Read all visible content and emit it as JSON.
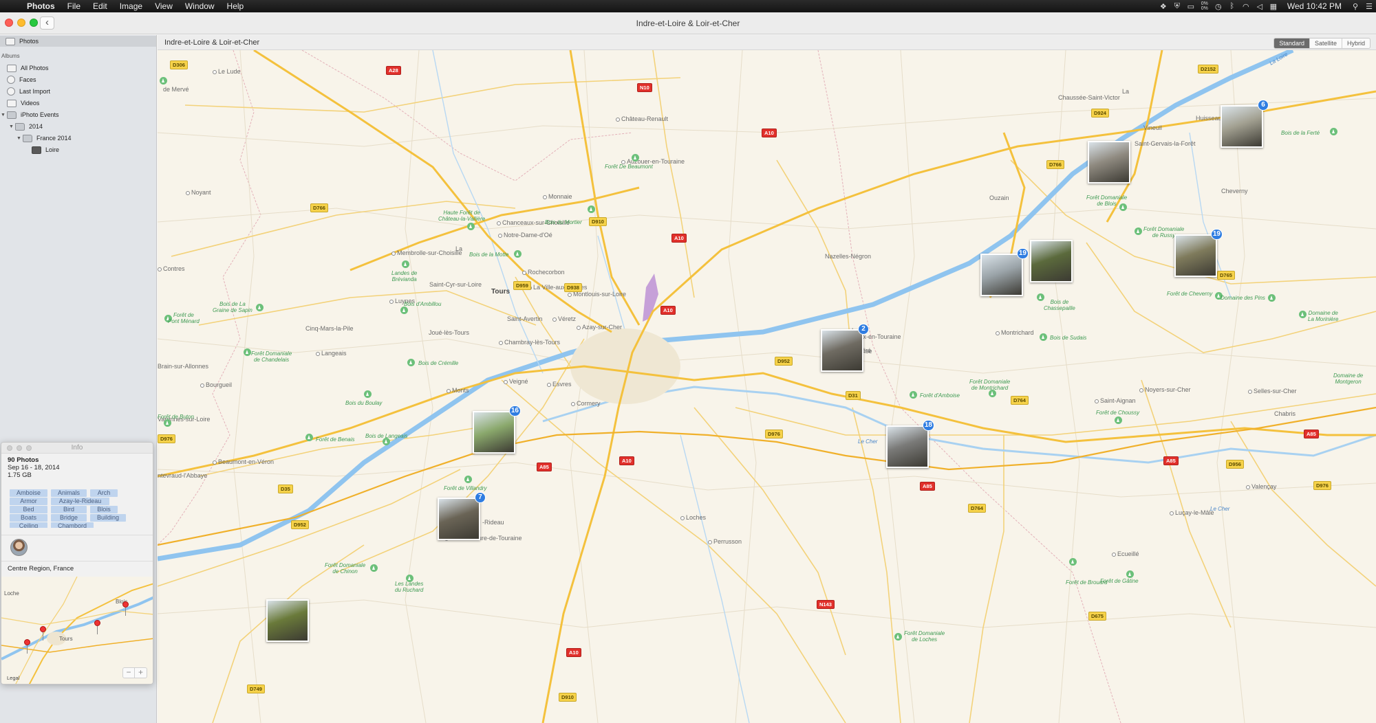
{
  "menubar": {
    "app": "Photos",
    "menus": [
      "File",
      "Edit",
      "Image",
      "View",
      "Window",
      "Help"
    ],
    "clock": "Wed 10:42 PM",
    "cpu_top": "0%",
    "cpu_bottom": "0%"
  },
  "window": {
    "title": "Indre-et-Loire & Loir-et-Cher"
  },
  "sidebar": {
    "top_item": "Photos",
    "albums_header": "Albums",
    "items": [
      {
        "label": "All Photos"
      },
      {
        "label": "Faces"
      },
      {
        "label": "Last Import"
      },
      {
        "label": "Videos"
      },
      {
        "label": "iPhoto Events"
      },
      {
        "label": "2014"
      },
      {
        "label": "France 2014"
      },
      {
        "label": "Loire"
      }
    ]
  },
  "map": {
    "title": "Indre-et-Loire & Loir-et-Cher",
    "map_types": [
      "Standard",
      "Satellite",
      "Hybrid"
    ],
    "selected_type": "Standard",
    "places": [
      {
        "name": "Tours",
        "city": true
      },
      {
        "name": "Le Lude"
      },
      {
        "name": "Noyant"
      },
      {
        "name": "Château-Renault"
      },
      {
        "name": "Auzouer-en-Touraine"
      },
      {
        "name": "Monnaie"
      },
      {
        "name": "Chanceaux-sur-Choisille"
      },
      {
        "name": "Notre-Dame-d'Oé"
      },
      {
        "name": "La"
      },
      {
        "name": "Membrolle-sur-Choisille"
      },
      {
        "name": "Saint-Cyr-sur-Loire"
      },
      {
        "name": "Rochecorbon"
      },
      {
        "name": "La Ville-aux-Dames"
      },
      {
        "name": "Montlouis-sur-Loire"
      },
      {
        "name": "Luynes"
      },
      {
        "name": "Saint-Avertin"
      },
      {
        "name": "Véretz"
      },
      {
        "name": "Joué-lès-Tours"
      },
      {
        "name": "Chambray-lès-Tours"
      },
      {
        "name": "Azay-sur-Cher"
      },
      {
        "name": "Cinq-Mars-la-Pile"
      },
      {
        "name": "Langeais"
      },
      {
        "name": "Brain-sur-Allonnes"
      },
      {
        "name": "Bourgueil"
      },
      {
        "name": "Varennes-sur-Loire"
      },
      {
        "name": "Monts"
      },
      {
        "name": "Veigné"
      },
      {
        "name": "Esvres"
      },
      {
        "name": "Cormery"
      },
      {
        "name": "Beaumont-en-Véron"
      },
      {
        "name": "ntevraud-l'Abbaye"
      },
      {
        "name": "Sainte-Maure-de-Touraine"
      },
      {
        "name": "Loches"
      },
      {
        "name": "Perrusson"
      },
      {
        "name": "Nazelles-Négron"
      },
      {
        "name": "La"
      },
      {
        "name": "Croix-en-Touraine"
      },
      {
        "name": "Bléré"
      },
      {
        "name": "Montrichard"
      },
      {
        "name": "Contres"
      },
      {
        "name": "Cheverny"
      },
      {
        "name": "Vineuil"
      },
      {
        "name": "Saint-Gervais-la-Forêt"
      },
      {
        "name": "Chaussée-Saint-Victor"
      },
      {
        "name": "La"
      },
      {
        "name": "Huisseau-sur-Cosson"
      },
      {
        "name": "Ouzain"
      },
      {
        "name": "Noyers-sur-Cher"
      },
      {
        "name": "Saint-Aignan"
      },
      {
        "name": "Selles-sur-Cher"
      },
      {
        "name": "Chabris"
      },
      {
        "name": "Valençay"
      },
      {
        "name": "Luçay-le-Mâle"
      },
      {
        "name": "Ecueillé"
      },
      {
        "name": "-Rideau"
      },
      {
        "name": "ise"
      },
      {
        "name": "de Mervé"
      }
    ],
    "forests": [
      "Forêt De Beaumont",
      "Bois du Mortier",
      "Bois de la Motte",
      "Haute Forêt de\nChâteau-la-Vallière",
      "Landes de\nBrévianda",
      "Bois d'Ambillou",
      "Bois de La\nGraine de Sapin",
      "Forêt de\nPont Ménard",
      "Forêt Domaniale\nde Chandelais",
      "Bois de Crémille",
      "Bois du Boulay",
      "Forêt de Buton",
      "Forêt de Benais",
      "Bois de Langeais",
      "Forêt de Villandry",
      "Forêt Domaniale\nde Chinon",
      "Les Landes\ndu Ruchard",
      "Forêt Domaniale\nde Blois",
      "Forêt Domaniale\nde Russy",
      "Bois de la Ferté",
      "Forêt de Cheverny",
      "Domaine des Pins",
      "Domaine de\nLa Morinière",
      "Bois de\nChassepaille",
      "Bois de Sudais",
      "Forêt d'Amboise",
      "Forêt Domaniale\nde Montrichard",
      "Forêt de Choussy",
      "Domaine de\nMontgeron",
      "Forêt de Brouard",
      "Forêt de Gâtine",
      "Forêt Domaniale\nde Loches"
    ],
    "roads": [
      "D306",
      "A28",
      "N10",
      "A10",
      "D2152",
      "D924",
      "D766",
      "D766",
      "D910",
      "A10",
      "D959",
      "D938",
      "A10",
      "D952",
      "D31",
      "D764",
      "D976",
      "D976",
      "A85",
      "A85",
      "A10",
      "A85",
      "D35",
      "D952",
      "D749",
      "D910",
      "A10",
      "D764",
      "N143",
      "D675",
      "A85",
      "D956",
      "D976",
      "D765"
    ],
    "rivers": [
      "La Loire",
      "Le Cher",
      "Le Cher"
    ],
    "clusters": [
      {
        "count": "16",
        "color": "#8aa86c"
      },
      {
        "count": "7",
        "color": "#6a6456"
      },
      {
        "count": "",
        "color": "#6a7a3a"
      },
      {
        "count": "2",
        "color": "#6f6b62"
      },
      {
        "count": "18",
        "color": "#7a7a78"
      },
      {
        "count": "19",
        "color": "#9aa3a8"
      },
      {
        "count": "",
        "color": "#5b6a3c"
      },
      {
        "count": "",
        "color": "#8f8a80"
      },
      {
        "count": "6",
        "color": "#a2a091"
      },
      {
        "count": "19",
        "color": "#7f7b5c"
      }
    ]
  },
  "info": {
    "title": "Info",
    "count": "90 Photos",
    "dates": "Sep 16 - 18, 2014",
    "size": "1.75 GB",
    "keywords": [
      "Amboise",
      "Animals",
      "Arch",
      "Armor",
      "Azay-le-Rideau",
      "Bed",
      "Bird",
      "Blois",
      "Boats",
      "Bridge",
      "Building",
      "Ceiling",
      "Chambord"
    ],
    "location": "Centre Region, France",
    "minimap": {
      "labels": [
        "Tours",
        "Blois",
        "Loche"
      ],
      "legal": "Legal",
      "zoom_out": "−",
      "zoom_in": "+"
    }
  }
}
